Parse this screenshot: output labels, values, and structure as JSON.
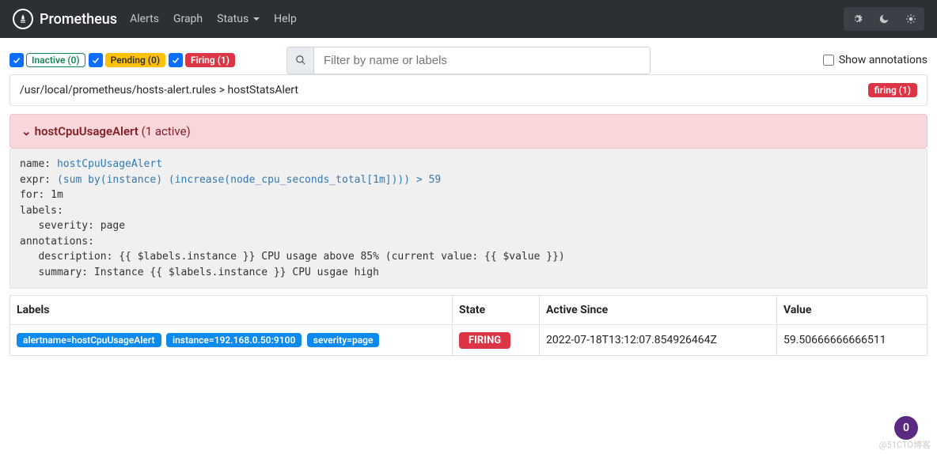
{
  "nav": {
    "brand": "Prometheus",
    "links": {
      "alerts": "Alerts",
      "graph": "Graph",
      "status": "Status",
      "help": "Help"
    }
  },
  "filters": {
    "inactive": "Inactive (0)",
    "pending": "Pending (0)",
    "firing": "Firing (1)",
    "search_placeholder": "Filter by name or labels",
    "show_annotations": "Show annotations"
  },
  "group": {
    "path": "/usr/local/prometheus/hosts-alert.rules > hostStatsAlert",
    "firing_badge": "firing (1)"
  },
  "alert": {
    "name": "hostCpuUsageAlert",
    "active_text": "(1 active)",
    "def": {
      "name_k": "name:",
      "name_v": "hostCpuUsageAlert",
      "expr_k": "expr:",
      "expr_v": "(sum by(instance) (increase(node_cpu_seconds_total[1m]))) > 59",
      "for_k": "for:",
      "for_v": "1m",
      "labels_k": "labels:",
      "severity": "severity: page",
      "annot_k": "annotations:",
      "desc": "description: {{ $labels.instance }} CPU usage above 85% (current value: {{ $value }})",
      "summary": "summary: Instance {{ $labels.instance }} CPU usgae high"
    }
  },
  "table": {
    "headers": {
      "labels": "Labels",
      "state": "State",
      "active_since": "Active Since",
      "value": "Value"
    },
    "row": {
      "label_alertname": "alertname=hostCpuUsageAlert",
      "label_instance": "instance=192.168.0.50:9100",
      "label_severity": "severity=page",
      "state": "FIRING",
      "active_since": "2022-07-18T13:12:07.854926464Z",
      "value": "59.50666666666511"
    }
  },
  "float_badge": "0",
  "watermark": "@51CTO博客"
}
